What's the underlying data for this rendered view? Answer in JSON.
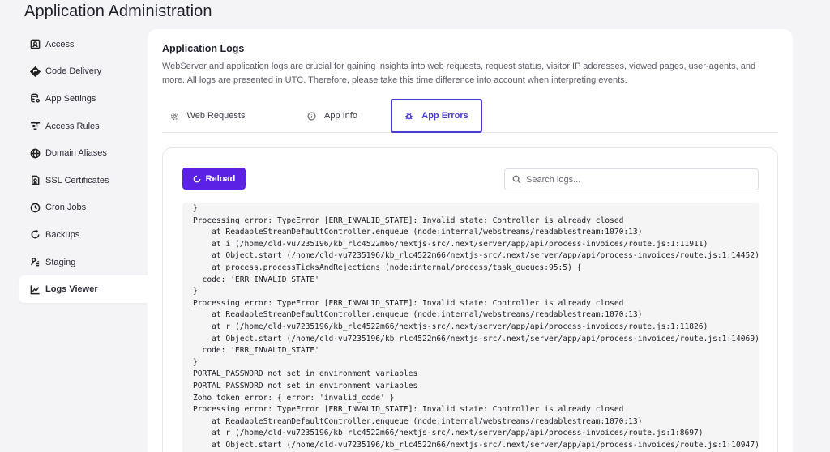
{
  "page_title": "Application Administration",
  "sidebar": {
    "items": [
      {
        "label": "Access",
        "icon": "id-card-icon"
      },
      {
        "label": "Code Delivery",
        "icon": "diamond-arrow-icon"
      },
      {
        "label": "App Settings",
        "icon": "database-gear-icon"
      },
      {
        "label": "Access Rules",
        "icon": "filter-rules-icon"
      },
      {
        "label": "Domain Aliases",
        "icon": "globe-icon"
      },
      {
        "label": "SSL Certificates",
        "icon": "certificate-icon"
      },
      {
        "label": "Cron Jobs",
        "icon": "clock-icon"
      },
      {
        "label": "Backups",
        "icon": "refresh-icon"
      },
      {
        "label": "Staging",
        "icon": "staging-icon"
      },
      {
        "label": "Logs Viewer",
        "icon": "chart-line-icon",
        "active": true
      }
    ]
  },
  "card": {
    "title": "Application Logs",
    "description": "WebServer and application logs are crucial for gaining insights into web requests, request status, visitor IP addresses, viewed pages, user-agents, and more. All logs are presented in UTC. Therefore, please take this time difference into account when interpreting events."
  },
  "tabs": [
    {
      "label": "Web Requests",
      "icon": "gear-icon"
    },
    {
      "label": "App Info",
      "icon": "info-circle-icon"
    },
    {
      "label": "App Errors",
      "icon": "bug-icon",
      "active": true
    }
  ],
  "toolbar": {
    "reload_label": "Reload",
    "search_placeholder": "Search logs..."
  },
  "logs": {
    "lines": [
      "}",
      "Processing error: TypeError [ERR_INVALID_STATE]: Invalid state: Controller is already closed",
      "    at ReadableStreamDefaultController.enqueue (node:internal/webstreams/readablestream:1070:13)",
      "    at i (/home/cld-vu7235196/kb_rlc4522m66/nextjs-src/.next/server/app/api/process-invoices/route.js:1:11911)",
      "    at Object.start (/home/cld-vu7235196/kb_rlc4522m66/nextjs-src/.next/server/app/api/process-invoices/route.js:1:14452)",
      "    at process.processTicksAndRejections (node:internal/process/task_queues:95:5) {",
      "  code: 'ERR_INVALID_STATE'",
      "}",
      "Processing error: TypeError [ERR_INVALID_STATE]: Invalid state: Controller is already closed",
      "    at ReadableStreamDefaultController.enqueue (node:internal/webstreams/readablestream:1070:13)",
      "    at r (/home/cld-vu7235196/kb_rlc4522m66/nextjs-src/.next/server/app/api/process-invoices/route.js:1:11826)",
      "    at Object.start (/home/cld-vu7235196/kb_rlc4522m66/nextjs-src/.next/server/app/api/process-invoices/route.js:1:14069)",
      "  code: 'ERR_INVALID_STATE'",
      "}",
      "PORTAL_PASSWORD not set in environment variables",
      "PORTAL_PASSWORD not set in environment variables",
      "Zoho token error: { error: 'invalid_code' }",
      "Processing error: TypeError [ERR_INVALID_STATE]: Invalid state: Controller is already closed",
      "    at ReadableStreamDefaultController.enqueue (node:internal/webstreams/readablestream:1070:13)",
      "    at r (/home/cld-vu7235196/kb_rlc4522m66/nextjs-src/.next/server/app/api/process-invoices/route.js:1:8697)",
      "    at Object.start (/home/cld-vu7235196/kb_rlc4522m66/nextjs-src/.next/server/app/api/process-invoices/route.js:1:10947)",
      "  code: 'ERR_INVALID_STATE'"
    ]
  },
  "colors": {
    "accent": "#5b22e6",
    "active_tab": "#4a3ad6",
    "background": "#f4f4f6"
  }
}
